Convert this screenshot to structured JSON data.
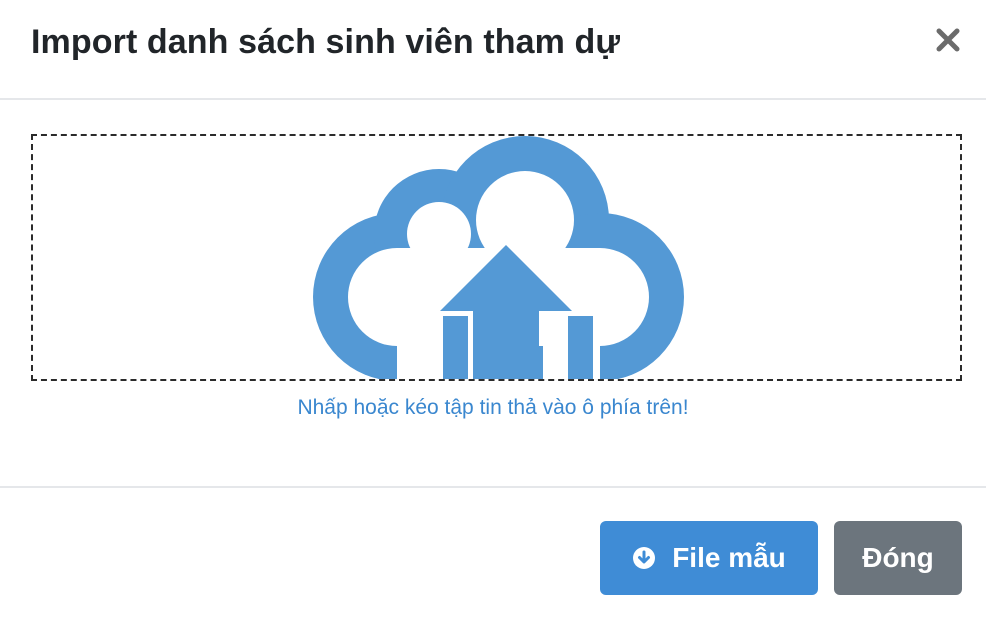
{
  "modal": {
    "title": "Import danh sách sinh viên tham dự",
    "close_label": "×"
  },
  "dropzone": {
    "icon": "cloud-upload-icon",
    "hint": "Nhấp hoặc kéo tập tin thả vào ô phía trên!"
  },
  "footer": {
    "template_button": {
      "label": "File mẫu",
      "icon": "download-circle-icon"
    },
    "close_button": {
      "label": "Đóng"
    }
  },
  "colors": {
    "primary": "#3f8cd6",
    "secondary": "#6c757d",
    "cloud": "#5499d5",
    "hint_text": "#3a87cf",
    "title_text": "#212529"
  }
}
